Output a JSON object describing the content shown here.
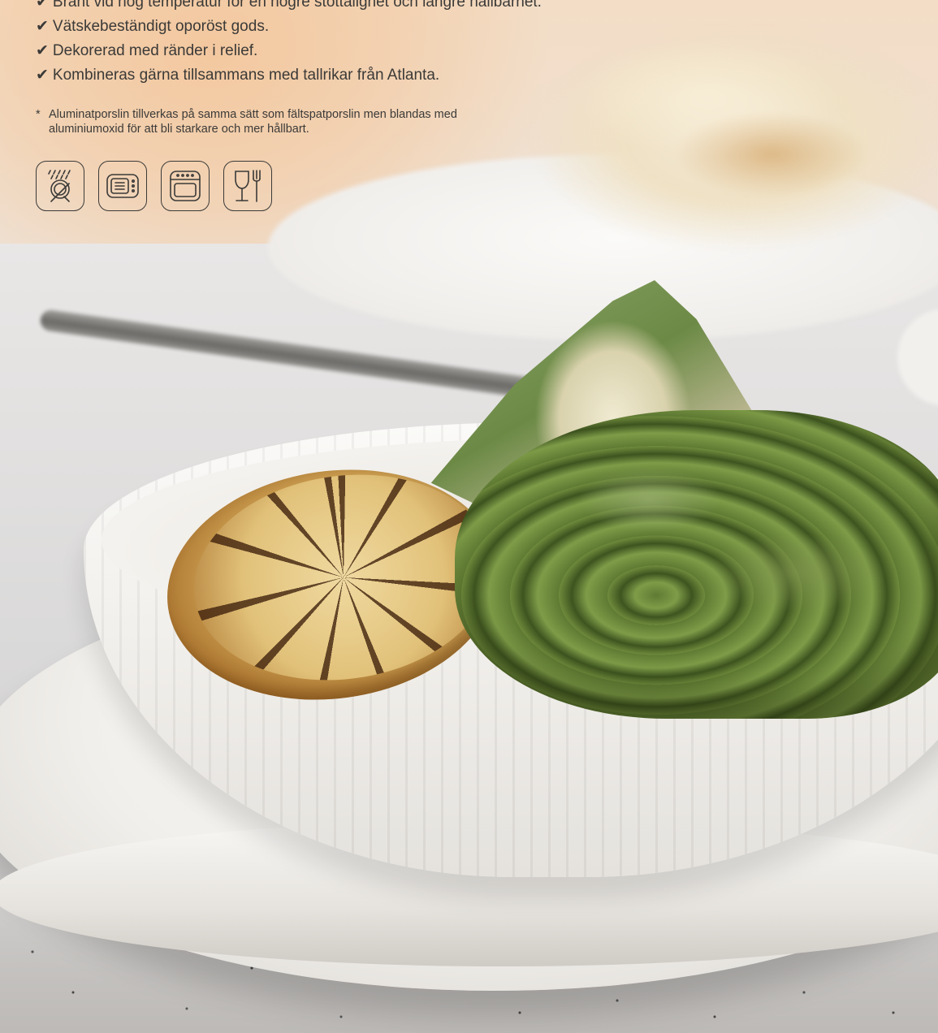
{
  "features": [
    {
      "check": "✔",
      "text": "Bränt vid hög temperatur för en högre stöttålighet och längre hållbarhet."
    },
    {
      "check": "✔",
      "text": "Vätskebeständigt oporöst gods."
    },
    {
      "check": "✔",
      "text": "Dekorerad med ränder i relief."
    },
    {
      "check": "✔",
      "text": "Kombineras gärna tillsammans med tallrikar från Atlanta."
    }
  ],
  "footnote": {
    "marker": "*",
    "text": "Aluminatporslin tillverkas på samma sätt som fältspatporslin men blandas med aluminiumoxid för att bli starkare och mer hållbart."
  },
  "icons": [
    "dishwasher-icon",
    "microwave-icon",
    "oven-icon",
    "food-safe-icon"
  ]
}
